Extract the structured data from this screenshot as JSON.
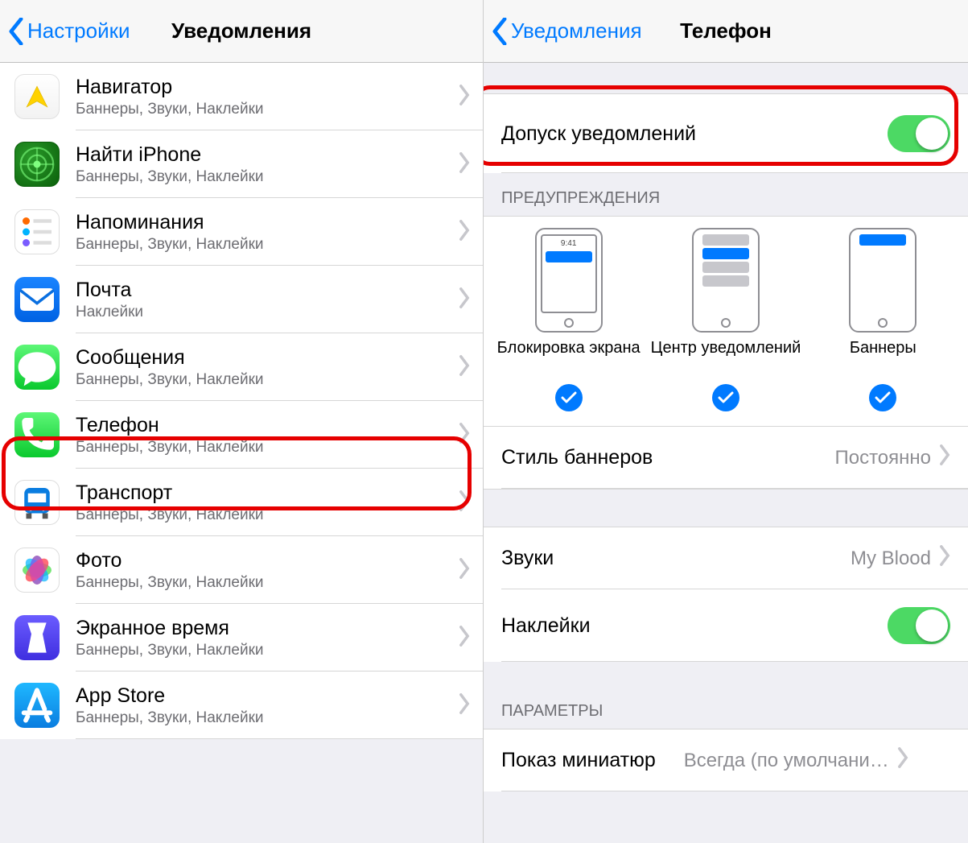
{
  "left": {
    "back": "Настройки",
    "title": "Уведомления",
    "apps": [
      {
        "name": "Навигатор",
        "sub": "Баннеры, Звуки, Наклейки",
        "icon": "navigator"
      },
      {
        "name": "Найти iPhone",
        "sub": "Баннеры, Звуки, Наклейки",
        "icon": "find"
      },
      {
        "name": "Напоминания",
        "sub": "Баннеры, Звуки, Наклейки",
        "icon": "reminders"
      },
      {
        "name": "Почта",
        "sub": "Наклейки",
        "icon": "mail"
      },
      {
        "name": "Сообщения",
        "sub": "Баннеры, Звуки, Наклейки",
        "icon": "messages"
      },
      {
        "name": "Телефон",
        "sub": "Баннеры, Звуки, Наклейки",
        "icon": "phone"
      },
      {
        "name": "Транспорт",
        "sub": "Баннеры, Звуки, Наклейки",
        "icon": "transit"
      },
      {
        "name": "Фото",
        "sub": "Баннеры, Звуки, Наклейки",
        "icon": "photos"
      },
      {
        "name": "Экранное время",
        "sub": "Баннеры, Звуки, Наклейки",
        "icon": "screentime"
      },
      {
        "name": "App Store",
        "sub": "Баннеры, Звуки, Наклейки",
        "icon": "appstore"
      }
    ]
  },
  "right": {
    "back": "Уведомления",
    "title": "Телефон",
    "allow": "Допуск уведомлений",
    "alerts_header": "ПРЕДУПРЕЖДЕНИЯ",
    "alert_options": {
      "lock": "Блокировка экрана",
      "center": "Центр уведомлений",
      "banners": "Баннеры",
      "time": "9:41"
    },
    "banner_style": {
      "label": "Стиль баннеров",
      "value": "Постоянно"
    },
    "sounds": {
      "label": "Звуки",
      "value": "My Blood"
    },
    "badges": {
      "label": "Наклейки"
    },
    "params_header": "ПАРАМЕТРЫ",
    "previews": {
      "label": "Показ миниатюр",
      "value": "Всегда (по умолчани…"
    }
  }
}
